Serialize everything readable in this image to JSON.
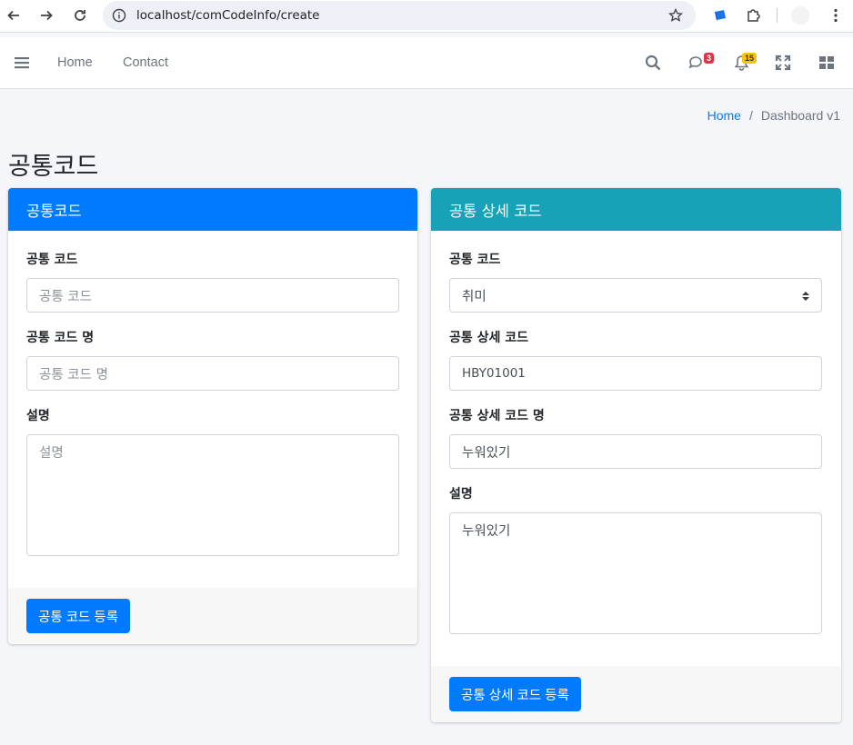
{
  "browser": {
    "url": "localhost/comCodeInfo/create"
  },
  "navbar": {
    "links": [
      "Home",
      "Contact"
    ],
    "messages_count": "3",
    "notifications_count": "15"
  },
  "breadcrumb": {
    "home": "Home",
    "separator": "/",
    "current": "Dashboard v1"
  },
  "page": {
    "title": "공통코드"
  },
  "left_card": {
    "header": "공통코드",
    "header_color": "#007bff",
    "fields": [
      {
        "label": "공통 코드",
        "placeholder": "공통 코드",
        "value": ""
      },
      {
        "label": "공통 코드 명",
        "placeholder": "공통 코드 명",
        "value": ""
      },
      {
        "label": "설명",
        "placeholder": "설명",
        "value": ""
      }
    ],
    "submit_label": "공통 코드 등록"
  },
  "right_card": {
    "header": "공통 상세 코드",
    "header_color": "#17a2b8",
    "fields": [
      {
        "label": "공통 코드",
        "selected": "취미"
      },
      {
        "label": "공통 상세 코드",
        "value": "HBY01001"
      },
      {
        "label": "공통 상세 코드 명",
        "value": "누워있기"
      },
      {
        "label": "설명",
        "value": "누워있기"
      }
    ],
    "submit_label": "공통 상세 코드 등록"
  }
}
